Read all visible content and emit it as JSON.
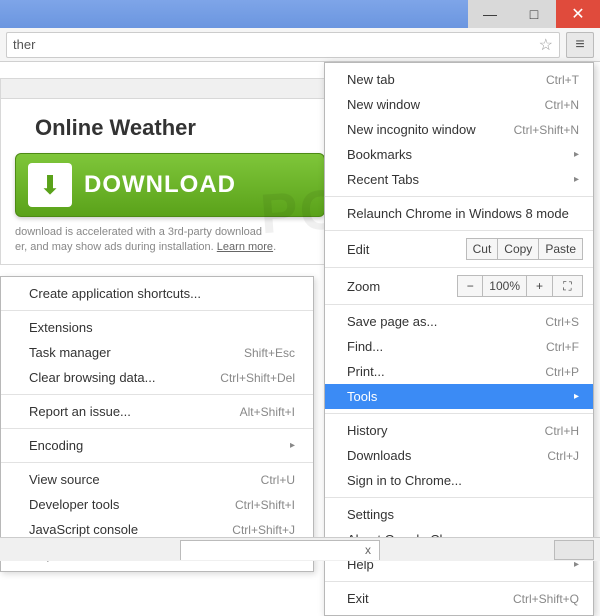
{
  "omnibox": {
    "text": "ther"
  },
  "ad": {
    "title": "Online Weather",
    "button": "DOWNLOAD",
    "disclaimer1": "download is accelerated with a 3rd-party download",
    "disclaimer2": "er, and may show ads during installation.",
    "learn_more": "Learn more"
  },
  "mainmenu": {
    "new_tab": "New tab",
    "new_tab_sc": "Ctrl+T",
    "new_window": "New window",
    "new_window_sc": "Ctrl+N",
    "incognito": "New incognito window",
    "incognito_sc": "Ctrl+Shift+N",
    "bookmarks": "Bookmarks",
    "recent": "Recent Tabs",
    "relaunch": "Relaunch Chrome in Windows 8 mode",
    "edit": "Edit",
    "cut": "Cut",
    "copy": "Copy",
    "paste": "Paste",
    "zoom": "Zoom",
    "zoom_val": "100%",
    "save": "Save page as...",
    "save_sc": "Ctrl+S",
    "find": "Find...",
    "find_sc": "Ctrl+F",
    "print": "Print...",
    "print_sc": "Ctrl+P",
    "tools": "Tools",
    "history": "History",
    "history_sc": "Ctrl+H",
    "downloads": "Downloads",
    "downloads_sc": "Ctrl+J",
    "signin": "Sign in to Chrome...",
    "settings": "Settings",
    "about": "About Google Chrome",
    "help": "Help",
    "exit": "Exit",
    "exit_sc": "Ctrl+Shift+Q"
  },
  "submenu": {
    "shortcuts": "Create application shortcuts...",
    "extensions": "Extensions",
    "taskmgr": "Task manager",
    "taskmgr_sc": "Shift+Esc",
    "clear": "Clear browsing data...",
    "clear_sc": "Ctrl+Shift+Del",
    "report": "Report an issue...",
    "report_sc": "Alt+Shift+I",
    "encoding": "Encoding",
    "source": "View source",
    "source_sc": "Ctrl+U",
    "devtools": "Developer tools",
    "devtools_sc": "Ctrl+Shift+I",
    "jsconsole": "JavaScript console",
    "jsconsole_sc": "Ctrl+Shift+J",
    "inspect": "Inspect devices"
  },
  "tab": {
    "close": "x"
  },
  "watermark": "PCrisk.com"
}
